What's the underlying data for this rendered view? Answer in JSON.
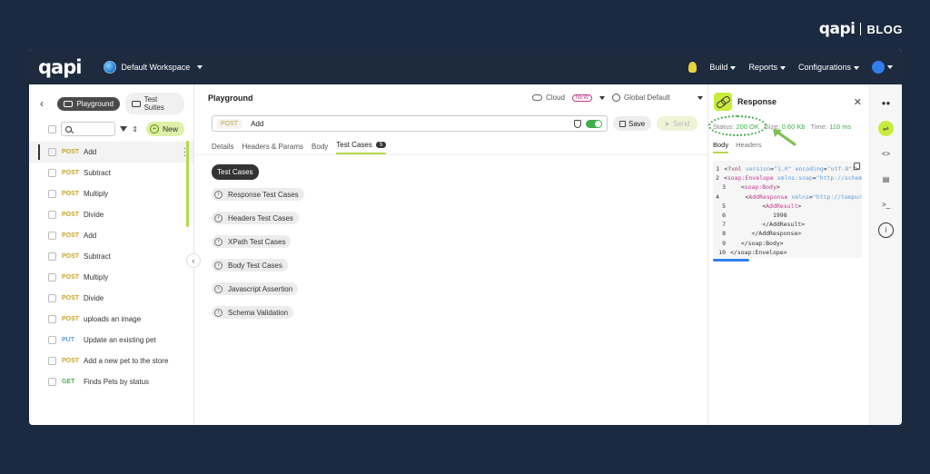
{
  "brand": {
    "logo": "qapi",
    "blog": "BLOG"
  },
  "app": {
    "logo": "qapi",
    "workspace": "Default Workspace",
    "nav": [
      "Build",
      "Reports",
      "Configurations"
    ]
  },
  "left": {
    "tabs": [
      "Playground",
      "Test Suites"
    ],
    "new_label": "New",
    "requests": [
      {
        "method": "POST",
        "name": "Add"
      },
      {
        "method": "POST",
        "name": "Subtract"
      },
      {
        "method": "POST",
        "name": "Multiply"
      },
      {
        "method": "POST",
        "name": "Divide"
      },
      {
        "method": "POST",
        "name": "Add"
      },
      {
        "method": "POST",
        "name": "Subtract"
      },
      {
        "method": "POST",
        "name": "Multiply"
      },
      {
        "method": "POST",
        "name": "Divide"
      },
      {
        "method": "POST",
        "name": "uploads an image"
      },
      {
        "method": "PUT",
        "name": "Update an existing pet"
      },
      {
        "method": "POST",
        "name": "Add a new pet to the store"
      },
      {
        "method": "GET",
        "name": "Finds Pets by status"
      }
    ]
  },
  "mid": {
    "title": "Playground",
    "cloud": "Cloud",
    "new_badge": "NEW",
    "env": "Global Default",
    "method": "POST",
    "url": "Add",
    "save": "Save",
    "send": "Send",
    "tabs": [
      "Details",
      "Headers & Params",
      "Body",
      "Test Cases"
    ],
    "test_cases_count": "5",
    "tc_active": "Test Cases",
    "tc_items": [
      "Response Test Cases",
      "Headers Test Cases",
      "XPath Test Cases",
      "Body Test Cases",
      "Javascript Assertion",
      "Schema Validation"
    ]
  },
  "response": {
    "title": "Response",
    "status_label": "Status:",
    "status_value": "200 OK",
    "size_label": "Size:",
    "size_value": "0.60 Kb",
    "time_label": "Time:",
    "time_value": "110 ms",
    "tabs": [
      "Body",
      "Headers"
    ],
    "code": [
      {
        "n": "1",
        "parts": [
          [
            "plain",
            "<?"
          ],
          [
            "tag",
            "xml"
          ],
          [
            "attr",
            " version"
          ],
          [
            "plain",
            "="
          ],
          [
            "attr",
            "\"1.0\""
          ],
          [
            "attr",
            " encoding"
          ],
          [
            "plain",
            "="
          ],
          [
            "attr",
            "\"utf-8\""
          ],
          [
            "plain",
            "?>"
          ]
        ]
      },
      {
        "n": "2",
        "parts": [
          [
            "plain",
            "<"
          ],
          [
            "tag",
            "soap:Envelope"
          ],
          [
            "attr",
            " xmlns:soap"
          ],
          [
            "plain",
            "="
          ],
          [
            "attr",
            "\"http://schem"
          ]
        ]
      },
      {
        "n": "3",
        "parts": [
          [
            "plain",
            "   <"
          ],
          [
            "tag",
            "soap:Body"
          ],
          [
            "plain",
            ">"
          ]
        ]
      },
      {
        "n": "4",
        "parts": [
          [
            "plain",
            "      <"
          ],
          [
            "tag",
            "AddResponse"
          ],
          [
            "attr",
            " xmlns"
          ],
          [
            "plain",
            "="
          ],
          [
            "attr",
            "\"http://tempur"
          ]
        ]
      },
      {
        "n": "5",
        "parts": [
          [
            "plain",
            "         <"
          ],
          [
            "tag",
            "AddResult"
          ],
          [
            "plain",
            ">"
          ]
        ]
      },
      {
        "n": "6",
        "parts": [
          [
            "plain",
            "            1998"
          ]
        ]
      },
      {
        "n": "7",
        "parts": [
          [
            "plain",
            "         </AddResult>"
          ]
        ]
      },
      {
        "n": "8",
        "parts": [
          [
            "plain",
            "      </AddResponse>"
          ]
        ]
      },
      {
        "n": "9",
        "parts": [
          [
            "plain",
            "   </soap:Body>"
          ]
        ]
      },
      {
        "n": "10",
        "parts": [
          [
            "plain",
            "</soap:Envelope>"
          ]
        ]
      }
    ]
  },
  "colors": {
    "accent": "#c8ec3c",
    "ok": "#3fae4a",
    "post": "#c9a227",
    "put": "#5aa0e0",
    "get": "#4caf50"
  }
}
